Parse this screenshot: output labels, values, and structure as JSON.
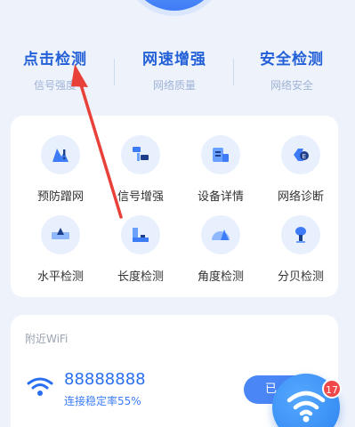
{
  "header_stats": [
    {
      "title": "点击检测",
      "subtitle": "信号强度"
    },
    {
      "title": "网速增强",
      "subtitle": "网络质量"
    },
    {
      "title": "安全检测",
      "subtitle": "网络安全"
    }
  ],
  "tools": [
    {
      "label": "预防蹭网",
      "icon": "shield-network-icon"
    },
    {
      "label": "信号增强",
      "icon": "signal-boost-icon"
    },
    {
      "label": "设备详情",
      "icon": "device-details-icon"
    },
    {
      "label": "网络诊断",
      "icon": "network-diagnose-icon"
    },
    {
      "label": "水平检测",
      "icon": "level-icon"
    },
    {
      "label": "长度检测",
      "icon": "ruler-icon"
    },
    {
      "label": "角度检测",
      "icon": "protractor-icon"
    },
    {
      "label": "分贝检测",
      "icon": "decibel-icon"
    }
  ],
  "wifi_section": {
    "title": "附近WiFi",
    "network_name": "88888888",
    "stability": "连接稳定率55%",
    "connect_label": "已"
  },
  "fab": {
    "badge_count": "17"
  },
  "colors": {
    "accent": "#2a6ef0",
    "arrow": "#e8413a",
    "badge": "#f04848"
  }
}
